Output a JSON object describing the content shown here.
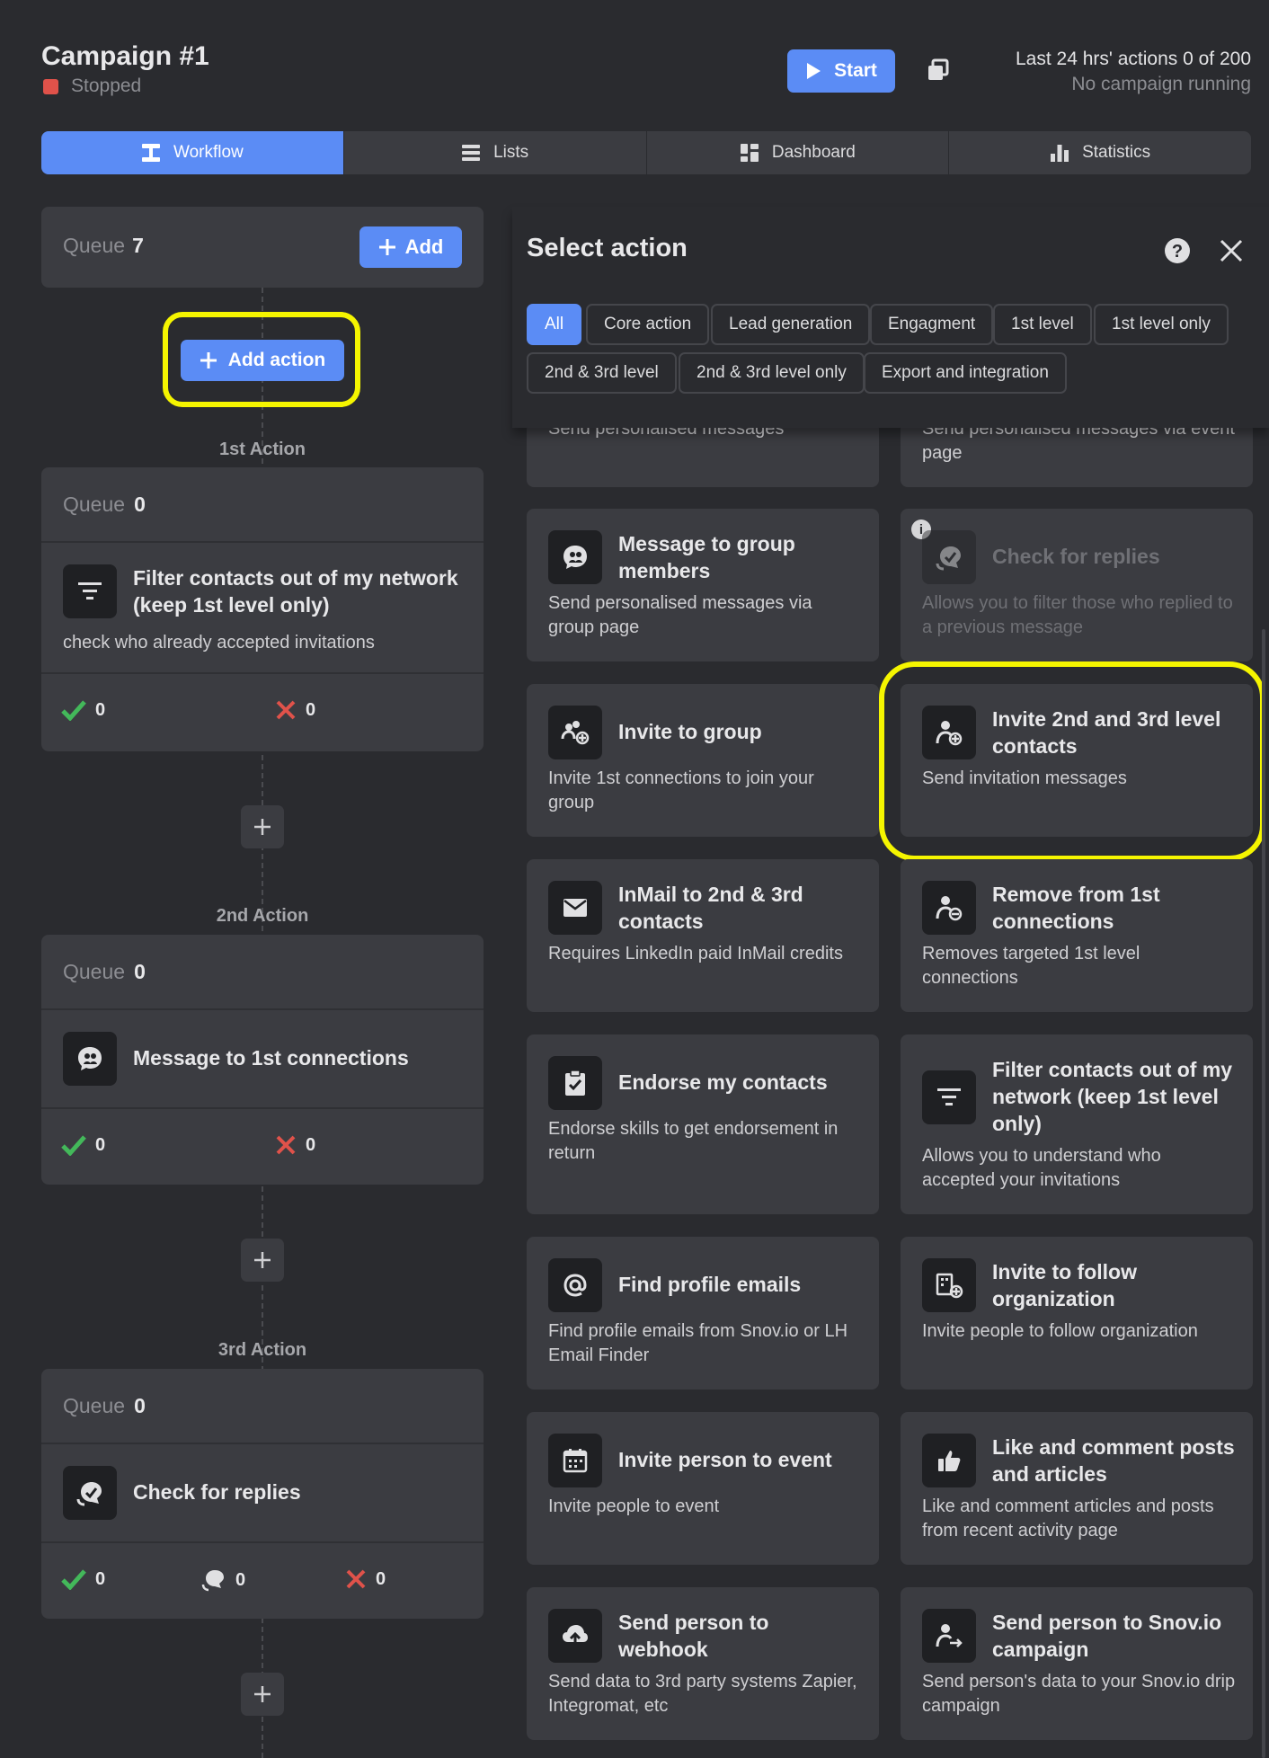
{
  "header": {
    "title": "Campaign #1",
    "status": "Stopped",
    "status_color": "#e0524a",
    "start_label": "Start",
    "actions_summary": "Last 24 hrs' actions 0 of 200",
    "running_status": "No campaign running"
  },
  "tabs": [
    {
      "label": "Workflow",
      "icon": "workflow-icon",
      "active": true
    },
    {
      "label": "Lists",
      "icon": "list-icon",
      "active": false
    },
    {
      "label": "Dashboard",
      "icon": "dashboard-icon",
      "active": false
    },
    {
      "label": "Statistics",
      "icon": "statistics-icon",
      "active": false
    }
  ],
  "workflow": {
    "queue_label": "Queue",
    "queue_count": "7",
    "add_label": "Add",
    "add_action_label": "Add action",
    "steps": [
      {
        "label": "1st Action",
        "queue_label": "Queue",
        "queue_count": "0",
        "title": "Filter contacts out of my network (keep 1st level only)",
        "desc": "check who already accepted invitations",
        "success": "0",
        "fail": "0"
      },
      {
        "label": "2nd Action",
        "queue_label": "Queue",
        "queue_count": "0",
        "title": "Message to 1st connections",
        "success": "0",
        "fail": "0"
      },
      {
        "label": "3rd Action",
        "queue_label": "Queue",
        "queue_count": "0",
        "title": "Check for replies",
        "success": "0",
        "replied": "0",
        "fail": "0"
      }
    ]
  },
  "panel": {
    "title": "Select action",
    "filters": [
      "All",
      "Core action",
      "Lead generation",
      "Engagment",
      "1st level",
      "1st level only",
      "2nd & 3rd level",
      "2nd & 3rd level only",
      "Export and integration"
    ],
    "top_partial": [
      "Send personalised messages",
      "Send personalised messages via event page"
    ],
    "cards": [
      {
        "title": "Message to group members",
        "desc": "Send personalised messages via group page",
        "icon": "group-message-icon"
      },
      {
        "title": "Check for replies",
        "desc": "Allows you to filter those who replied to a previous message",
        "icon": "replies-icon",
        "disabled": true
      },
      {
        "title": "Invite to group",
        "desc": "Invite 1st connections to join your group",
        "icon": "invite-group-icon"
      },
      {
        "title": "Invite 2nd and 3rd level contacts",
        "desc": "Send invitation messages",
        "icon": "person-add-icon"
      },
      {
        "title": "InMail to 2nd & 3rd contacts",
        "desc": "Requires LinkedIn paid InMail credits",
        "icon": "mail-icon"
      },
      {
        "title": "Remove from 1st connections",
        "desc": "Removes targeted 1st level connections",
        "icon": "person-remove-icon"
      },
      {
        "title": "Endorse my contacts",
        "desc": "Endorse skills to get endorsement in return",
        "icon": "clipboard-check-icon"
      },
      {
        "title": "Filter contacts out of my network (keep 1st level only)",
        "desc": "Allows you to understand who accepted your invitations",
        "icon": "filter-icon"
      },
      {
        "title": "Find profile emails",
        "desc": "Find profile emails from Snov.io or LH Email Finder",
        "icon": "at-icon"
      },
      {
        "title": "Invite to follow organization",
        "desc": "Invite people to follow organization",
        "icon": "organization-icon"
      },
      {
        "title": "Invite person to event",
        "desc": "Invite people to event",
        "icon": "calendar-icon"
      },
      {
        "title": "Like and comment posts and articles",
        "desc": "Like and comment articles and posts from recent activity page",
        "icon": "thumbs-up-icon"
      },
      {
        "title": "Send person to webhook",
        "desc": "Send data to 3rd party systems Zapier, Integromat, etc",
        "icon": "cloud-upload-icon"
      },
      {
        "title": "Send person to Snov.io campaign",
        "desc": "Send person's data to your Snov.io drip campaign",
        "icon": "person-send-icon"
      }
    ]
  },
  "colors": {
    "accent": "#5b8cf5",
    "highlight": "#f5f500",
    "success": "#43b85a",
    "danger": "#e0524a"
  }
}
